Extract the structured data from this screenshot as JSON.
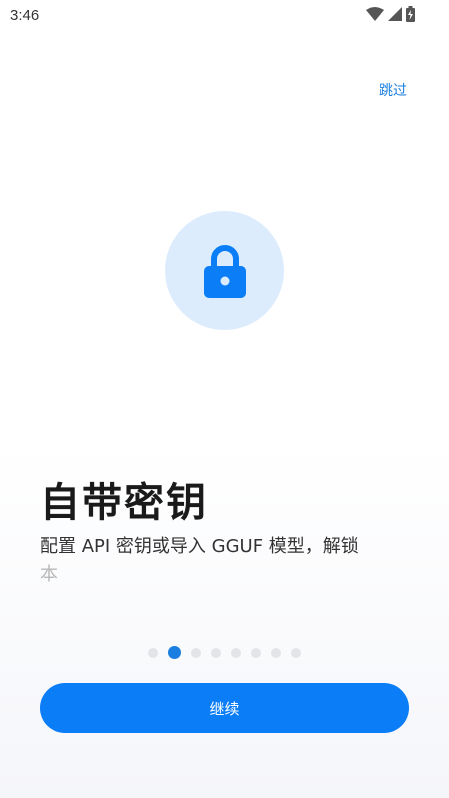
{
  "status_bar": {
    "time": "3:46",
    "icons": [
      "wifi-icon",
      "signal-icon",
      "battery-icon"
    ]
  },
  "skip_label": "跳过",
  "hero_icon": "lock-icon",
  "title": "自带密钥",
  "subtitle_main": "配置 API 密钥或导入 GGUF 模型，解锁",
  "subtitle_faded": "本",
  "pager": {
    "total": 8,
    "active_index": 1
  },
  "continue_label": "继续",
  "colors": {
    "accent": "#0a7df7",
    "hero_bg": "#dcecfd",
    "dot_inactive": "#e3e4e7"
  }
}
